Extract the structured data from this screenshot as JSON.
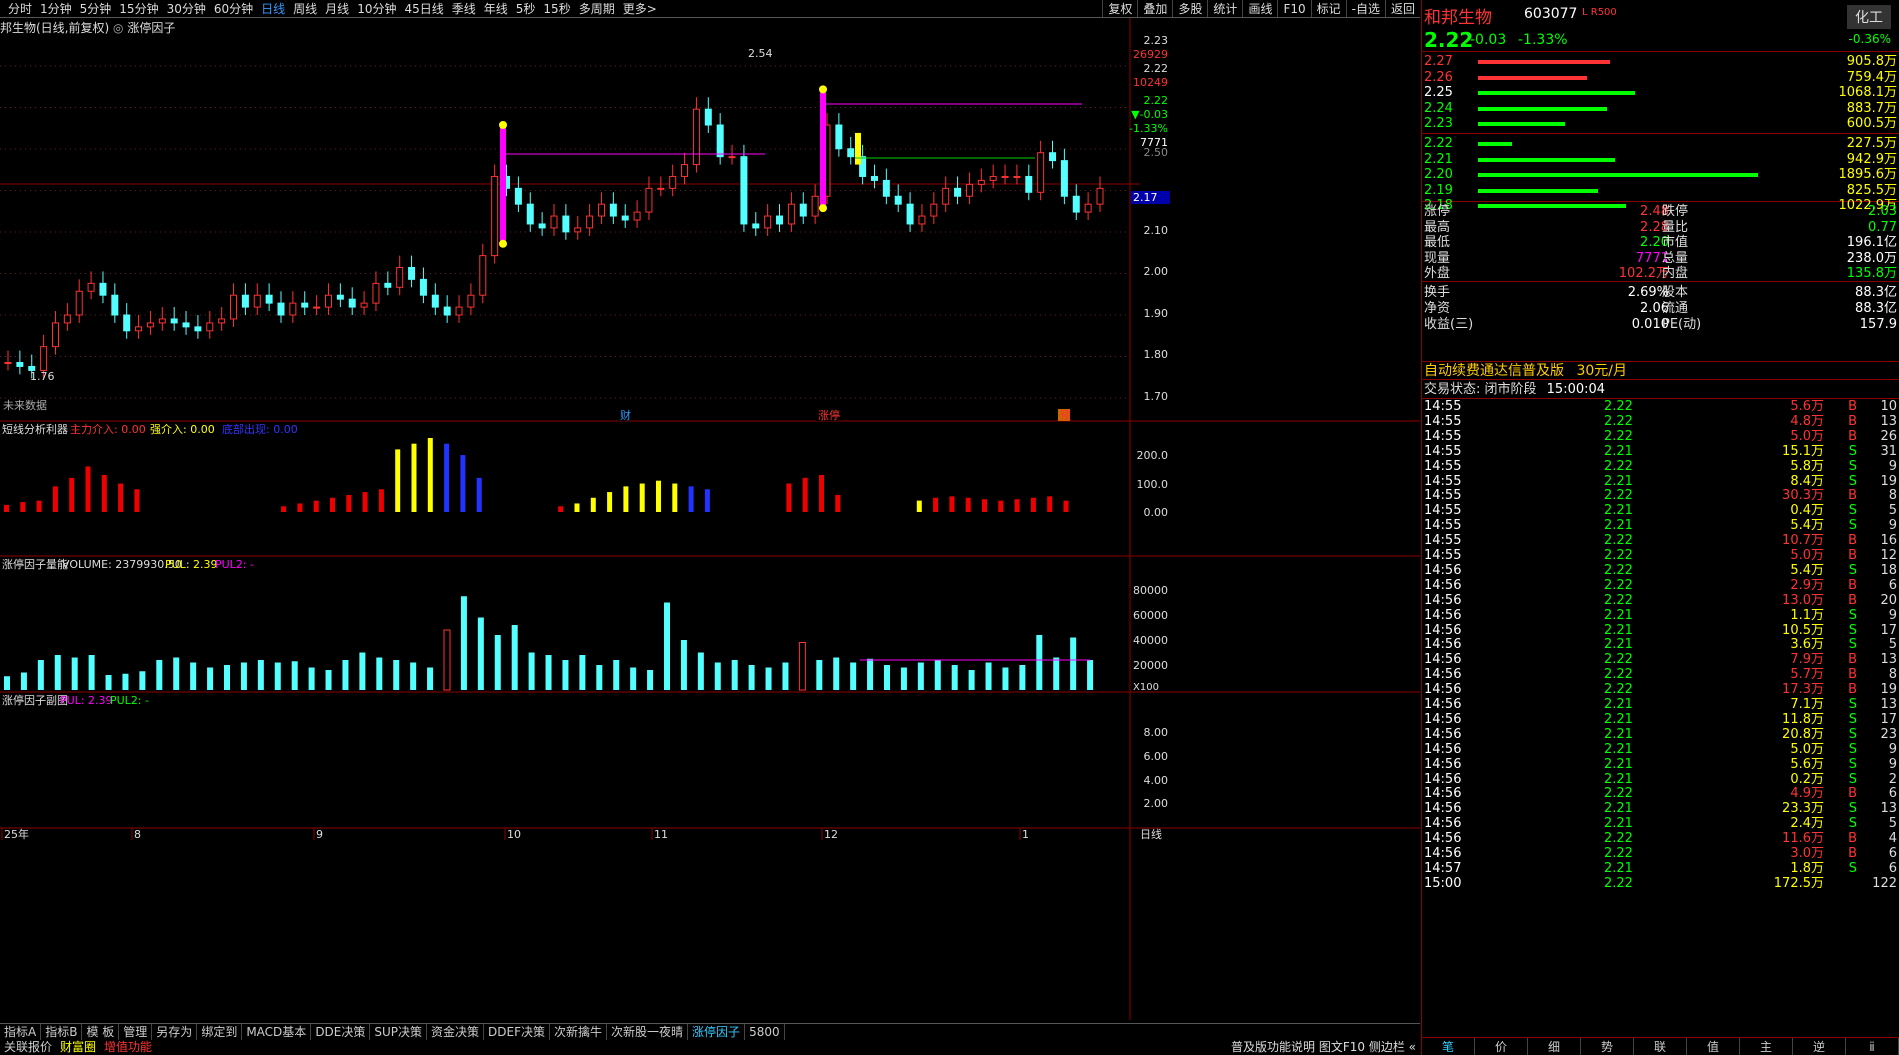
{
  "topbar": {
    "periods": [
      "分时",
      "1分钟",
      "5分钟",
      "15分钟",
      "30分钟",
      "60分钟",
      "日线",
      "周线",
      "月线",
      "10分钟",
      "45日线",
      "季线",
      "年线",
      "5秒",
      "15秒",
      "多周期",
      "更多>"
    ],
    "active": "日线",
    "tools": [
      "复权",
      "叠加",
      "多股",
      "统计",
      "画线",
      "F10",
      "标记",
      "-自选",
      "返回"
    ]
  },
  "chart_title": "邦生物(日线,前复权)",
  "chart_indicator_name": "涨停因子",
  "price_annot": {
    "high": "2.54",
    "low": "1.76",
    "current": "2.17"
  },
  "price_axis": [
    "2.10",
    "2.00",
    "1.90",
    "1.80",
    "1.70"
  ],
  "price_axis_top": [
    "2.23",
    "26929",
    "2.22",
    "10249",
    "2.22",
    "▼-0.03",
    "-1.33%",
    "7771",
    "2.50"
  ],
  "event_tags": [
    "财",
    "涨停",
    "预"
  ],
  "no_data_label": "未来数据",
  "ind1": {
    "name": "短线分析利器",
    "l1": "主力介入: 0.00",
    "l2": "强介入: 0.00",
    "l3": "底部出现: 0.00",
    "axis": [
      "200.0",
      "100.0",
      "0.00"
    ]
  },
  "ind2": {
    "name": "涨停因子量能",
    "vol": "VOLUME: 2379930.50",
    "pul": "PUL: 2.39",
    "pul2": "PUL2: -",
    "axis": [
      "80000",
      "60000",
      "40000",
      "20000"
    ],
    "unit": "X100"
  },
  "ind3": {
    "name": "涨停因子副图",
    "pul": "PUL: 2.39",
    "pul2": "PUL2: -",
    "axis": [
      "8.00",
      "6.00",
      "4.00",
      "2.00"
    ]
  },
  "date_axis": [
    "25年",
    "8",
    "9",
    "10",
    "11",
    "12",
    "1"
  ],
  "date_right": "日线",
  "bottom_tabs": [
    "指标A",
    "指标B",
    "模 板",
    "管理",
    "另存为",
    "绑定到",
    "MACD基本",
    "DDE决策",
    "SUP决策",
    "资金决策",
    "DDEF决策",
    "次新擒牛",
    "次新股一夜晴",
    "涨停因子",
    "5800"
  ],
  "bottom_tabs_active": "涨停因子",
  "bottom_links": [
    "关联报价",
    "财富圈",
    "增值功能"
  ],
  "bottom_right": [
    "普及版功能说明",
    "图文F10",
    "侧边栏",
    "«"
  ],
  "stock": {
    "name": "和邦生物",
    "code": "603077",
    "flags": "L R500",
    "price": "2.22",
    "change": "-0.03",
    "pct": "-1.33%",
    "sector": "化工",
    "sector_pct": "-0.36%"
  },
  "asks": [
    {
      "p": "2.27",
      "v": "905.8万",
      "w": 0.47
    },
    {
      "p": "2.26",
      "v": "759.4万",
      "w": 0.39
    },
    {
      "p": "2.25",
      "v": "1068.1万",
      "w": 0.56
    },
    {
      "p": "2.24",
      "v": "883.7万",
      "w": 0.46
    },
    {
      "p": "2.23",
      "v": "600.5万",
      "w": 0.31
    }
  ],
  "bids": [
    {
      "p": "2.22",
      "v": "227.5万",
      "w": 0.12
    },
    {
      "p": "2.21",
      "v": "942.9万",
      "w": 0.49
    },
    {
      "p": "2.20",
      "v": "1895.6万",
      "w": 1.0
    },
    {
      "p": "2.19",
      "v": "825.5万",
      "w": 0.43
    },
    {
      "p": "2.18",
      "v": "1022.9万",
      "w": 0.53
    }
  ],
  "stats": [
    [
      "涨停",
      "2.48",
      "跌停",
      "2.03"
    ],
    [
      "最高",
      "2.28",
      "量比",
      "0.77"
    ],
    [
      "最低",
      "2.20",
      "市值",
      "196.1亿"
    ],
    [
      "现量",
      "7771",
      "总量",
      "238.0万"
    ],
    [
      "外盘",
      "102.2万",
      "内盘",
      "135.8万"
    ],
    [
      "换手",
      "2.69%",
      "股本",
      "88.3亿"
    ],
    [
      "净资",
      "2.06",
      "流通",
      "88.3亿"
    ],
    [
      "收益(三)",
      "0.010",
      "PE(动)",
      "157.9"
    ]
  ],
  "promo": "自动续费通达信普及版",
  "promo_price": "30元/月",
  "trade_status_label": "交易状态: 闭市阶段",
  "trade_status_time": "15:00:04",
  "ticks": [
    [
      "14:55",
      "2.22",
      "5.6万",
      "B",
      "10"
    ],
    [
      "14:55",
      "2.22",
      "4.8万",
      "B",
      "13"
    ],
    [
      "14:55",
      "2.22",
      "5.0万",
      "B",
      "26"
    ],
    [
      "14:55",
      "2.21",
      "15.1万",
      "S",
      "31"
    ],
    [
      "14:55",
      "2.22",
      "5.8万",
      "S",
      "9"
    ],
    [
      "14:55",
      "2.21",
      "8.4万",
      "S",
      "19"
    ],
    [
      "14:55",
      "2.22",
      "30.3万",
      "B",
      "8"
    ],
    [
      "14:55",
      "2.21",
      "0.4万",
      "S",
      "5"
    ],
    [
      "14:55",
      "2.21",
      "5.4万",
      "S",
      "9"
    ],
    [
      "14:55",
      "2.22",
      "10.7万",
      "B",
      "16"
    ],
    [
      "14:55",
      "2.22",
      "5.0万",
      "B",
      "12"
    ],
    [
      "14:56",
      "2.22",
      "5.4万",
      "S",
      "18"
    ],
    [
      "14:56",
      "2.22",
      "2.9万",
      "B",
      "6"
    ],
    [
      "14:56",
      "2.22",
      "13.0万",
      "B",
      "20"
    ],
    [
      "14:56",
      "2.21",
      "1.1万",
      "S",
      "9"
    ],
    [
      "14:56",
      "2.21",
      "10.5万",
      "S",
      "17"
    ],
    [
      "14:56",
      "2.21",
      "3.6万",
      "S",
      "5"
    ],
    [
      "14:56",
      "2.22",
      "7.9万",
      "B",
      "13"
    ],
    [
      "14:56",
      "2.22",
      "5.7万",
      "B",
      "8"
    ],
    [
      "14:56",
      "2.22",
      "17.3万",
      "B",
      "19"
    ],
    [
      "14:56",
      "2.21",
      "7.1万",
      "S",
      "13"
    ],
    [
      "14:56",
      "2.21",
      "11.8万",
      "S",
      "17"
    ],
    [
      "14:56",
      "2.21",
      "20.8万",
      "S",
      "23"
    ],
    [
      "14:56",
      "2.21",
      "5.0万",
      "S",
      "9"
    ],
    [
      "14:56",
      "2.21",
      "5.6万",
      "S",
      "9"
    ],
    [
      "14:56",
      "2.21",
      "0.2万",
      "S",
      "2"
    ],
    [
      "14:56",
      "2.22",
      "4.9万",
      "B",
      "6"
    ],
    [
      "14:56",
      "2.21",
      "23.3万",
      "S",
      "13"
    ],
    [
      "14:56",
      "2.21",
      "2.4万",
      "S",
      "5"
    ],
    [
      "14:56",
      "2.22",
      "11.6万",
      "B",
      "4"
    ],
    [
      "14:56",
      "2.22",
      "3.0万",
      "B",
      "6"
    ],
    [
      "14:57",
      "2.21",
      "1.8万",
      "S",
      "6"
    ],
    [
      "15:00",
      "2.22",
      "172.5万",
      "",
      "122"
    ]
  ],
  "rp_tabs": [
    "笔",
    "价",
    "细",
    "势",
    "联",
    "值",
    "主",
    "逆",
    "ⅱ"
  ],
  "chart_data": {
    "type": "candlestick",
    "series_close": [
      1.78,
      1.77,
      1.76,
      1.82,
      1.88,
      1.9,
      1.96,
      1.98,
      1.95,
      1.9,
      1.86,
      1.87,
      1.88,
      1.89,
      1.88,
      1.87,
      1.86,
      1.88,
      1.89,
      1.95,
      1.92,
      1.95,
      1.93,
      1.9,
      1.93,
      1.92,
      1.92,
      1.95,
      1.94,
      1.92,
      1.93,
      1.98,
      1.97,
      2.02,
      1.99,
      1.95,
      1.92,
      1.9,
      1.92,
      1.95,
      2.05,
      2.25,
      2.22,
      2.18,
      2.13,
      2.12,
      2.15,
      2.11,
      2.12,
      2.15,
      2.18,
      2.15,
      2.14,
      2.16,
      2.22,
      2.22,
      2.25,
      2.28,
      2.42,
      2.38,
      2.3,
      2.3,
      2.13,
      2.12,
      2.15,
      2.13,
      2.18,
      2.15,
      2.2,
      2.38,
      2.32,
      2.3,
      2.25,
      2.24,
      2.2,
      2.18,
      2.13,
      2.15,
      2.18,
      2.22,
      2.2,
      2.23,
      2.24,
      2.25,
      2.25,
      2.25,
      2.21,
      2.31,
      2.29,
      2.2,
      2.16,
      2.18,
      2.22
    ],
    "ylim": [
      1.66,
      2.62
    ],
    "marks": {
      "high": 2.54,
      "low": 1.76,
      "last": 2.17
    },
    "macd_like": [
      25,
      35,
      40,
      90,
      120,
      160,
      130,
      100,
      80,
      0,
      0,
      0,
      0,
      0,
      0,
      0,
      0,
      20,
      30,
      40,
      50,
      60,
      70,
      80,
      220,
      240,
      260,
      240,
      200,
      120,
      0,
      0,
      0,
      0,
      20,
      30,
      50,
      70,
      90,
      100,
      110,
      100,
      90,
      80,
      0,
      0,
      0,
      0,
      100,
      120,
      130,
      60,
      0,
      0,
      0,
      0,
      40,
      50,
      55,
      50,
      45,
      40,
      45,
      50,
      55,
      40
    ],
    "volume": [
      11000,
      14000,
      24000,
      28000,
      26000,
      28000,
      12000,
      13000,
      15000,
      24000,
      26000,
      22000,
      18000,
      20000,
      22000,
      24000,
      22000,
      23000,
      18000,
      16000,
      24000,
      30000,
      26000,
      24000,
      22000,
      18000,
      48000,
      75000,
      58000,
      44000,
      52000,
      30000,
      28000,
      24000,
      28000,
      20000,
      24000,
      18000,
      16000,
      70000,
      40000,
      30000,
      22000,
      24000,
      20000,
      18000,
      22000,
      38000,
      24000,
      26000,
      22000,
      25000,
      20000,
      18000,
      22000,
      24000,
      20000,
      16000,
      22000,
      18000,
      20000,
      44000,
      26000,
      42000,
      24000
    ]
  }
}
